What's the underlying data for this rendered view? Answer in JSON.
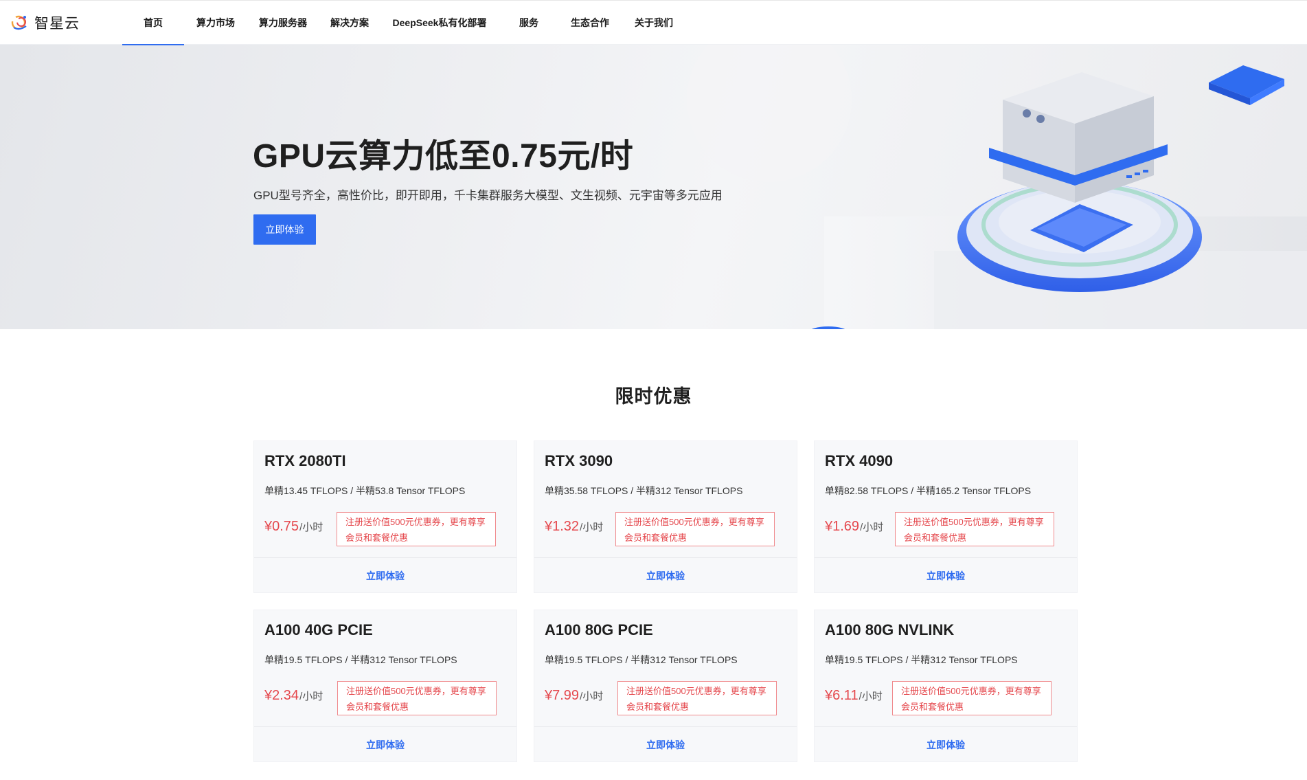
{
  "brand": {
    "name": "智星云"
  },
  "nav": {
    "items": [
      {
        "label": "首页",
        "active": true
      },
      {
        "label": "算力市场"
      },
      {
        "label": "算力服务器"
      },
      {
        "label": "解决方案"
      },
      {
        "label": "DeepSeek私有化部署"
      },
      {
        "label": "服务"
      },
      {
        "label": "生态合作"
      },
      {
        "label": "关于我们"
      }
    ]
  },
  "hero": {
    "title": "GPU云算力低至0.75元/时",
    "subtitle": "GPU型号齐全，高性价比，即开即用，千卡集群服务大模型、文生视频、元宇宙等多元应用",
    "cta": "立即体验",
    "illustration": "gpu-server-platform-illustration"
  },
  "offers": {
    "title": "限时优惠",
    "cards": [
      {
        "name": "RTX 2080TI",
        "spec": "单精13.45 TFLOPS / 半精53.8 Tensor TFLOPS",
        "price": "¥0.75",
        "unit": "/小时",
        "promo": "注册送价值500元优惠券，更有尊享会员和套餐优惠",
        "action": "立即体验"
      },
      {
        "name": "RTX 3090",
        "spec": "单精35.58 TFLOPS / 半精312 Tensor TFLOPS",
        "price": "¥1.32",
        "unit": "/小时",
        "promo": "注册送价值500元优惠券，更有尊享会员和套餐优惠",
        "action": "立即体验"
      },
      {
        "name": "RTX 4090",
        "spec": "单精82.58 TFLOPS / 半精165.2 Tensor TFLOPS",
        "price": "¥1.69",
        "unit": "/小时",
        "promo": "注册送价值500元优惠券，更有尊享会员和套餐优惠",
        "action": "立即体验"
      },
      {
        "name": "A100 40G PCIE",
        "spec": "单精19.5 TFLOPS / 半精312 Tensor TFLOPS",
        "price": "¥2.34",
        "unit": "/小时",
        "promo": "注册送价值500元优惠券，更有尊享会员和套餐优惠",
        "action": "立即体验"
      },
      {
        "name": "A100 80G PCIE",
        "spec": "单精19.5 TFLOPS / 半精312 Tensor TFLOPS",
        "price": "¥7.99",
        "unit": "/小时",
        "promo": "注册送价值500元优惠券，更有尊享会员和套餐优惠",
        "action": "立即体验"
      },
      {
        "name": "A100 80G NVLINK",
        "spec": "单精19.5 TFLOPS / 半精312 Tensor TFLOPS",
        "price": "¥6.11",
        "unit": "/小时",
        "promo": "注册送价值500元优惠券，更有尊享会员和套餐优惠",
        "action": "立即体验"
      }
    ]
  },
  "colors": {
    "accent": "#2f6cf0",
    "price": "#e5484d",
    "promo_border": "#f08a8d"
  }
}
